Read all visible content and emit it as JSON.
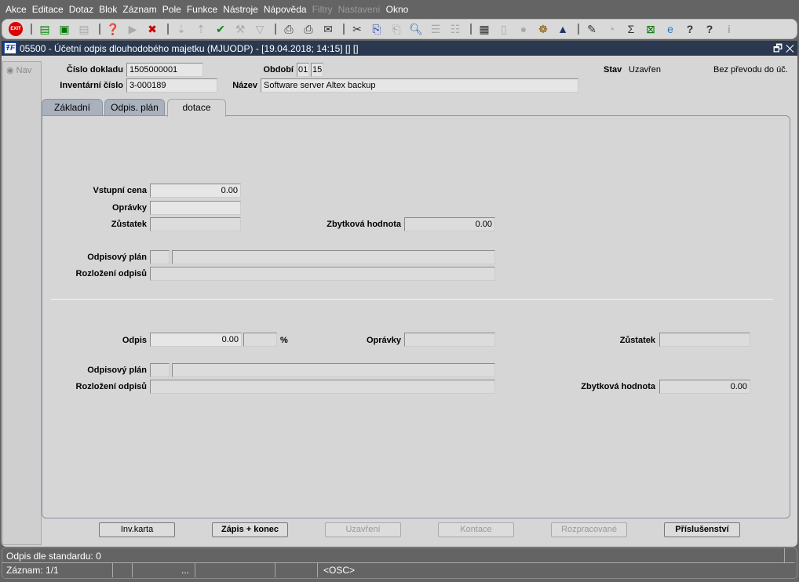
{
  "menu": [
    "Akce",
    "Editace",
    "Dotaz",
    "Blok",
    "Záznam",
    "Pole",
    "Funkce",
    "Nástroje",
    "Nápověda",
    "Filtry",
    "Nastavení",
    "Okno"
  ],
  "menu_disabled": [
    "Filtry",
    "Nastavení"
  ],
  "toolbar": [
    "exit-icon",
    "insert-record-icon",
    "save-record-icon",
    "delete-record-icon",
    "query-icon",
    "execute-query-icon",
    "cancel-query-icon",
    "sort-asc-icon",
    "sort-desc-icon",
    "commit-icon",
    "tools-icon",
    "filter-icon",
    "print-icon",
    "print-setup-icon",
    "mail-icon",
    "cut-icon",
    "copy-icon",
    "paste-icon",
    "find-icon",
    "indent-icon",
    "columns-icon",
    "report-icon",
    "document-icon",
    "globe-icon",
    "wheel-icon",
    "eye-icon",
    "edit-icon",
    "clock-icon",
    "sum-icon",
    "excel-icon",
    "ie-icon",
    "help-icon",
    "help-window-icon",
    "info-icon"
  ],
  "title": "05500 - Účetní odpis dlouhodobého majetku (MJUODP) - [19.04.2018; 14:15] [] []",
  "nav": "Nav",
  "header": {
    "cislo_label": "Číslo dokladu",
    "cislo": "1505000001",
    "obdobi_label": "Období",
    "obdobi_m": "01",
    "obdobi_y": "15",
    "stav_label": "Stav",
    "stav": "Uzavřen",
    "prevod": "Bez převodu do úč.",
    "inv_label": "Inventární číslo",
    "inv": "3-000189",
    "nazev_label": "Název",
    "nazev": "Software server Altex backup"
  },
  "tabs": [
    "Základní",
    "Odpis. plán",
    "dotace"
  ],
  "top": {
    "vstupni_label": "Vstupní cena",
    "vstupni": "0.00",
    "opravky_label": "Oprávky",
    "zustatek_label": "Zůstatek",
    "zbytkova_label": "Zbytková hodnota",
    "zbytkova": "0.00",
    "plan_label": "Odpisový plán",
    "rozlozeni_label": "Rozložení odpisů"
  },
  "bottom": {
    "odpis_label": "Odpis",
    "odpis": "0.00",
    "pct": "%",
    "opravky_label": "Oprávky",
    "zustatek_label": "Zůstatek",
    "plan_label": "Odpisový plán",
    "rozlozeni_label": "Rozložení odpisů",
    "zbytkova_label": "Zbytková hodnota",
    "zbytkova": "0.00"
  },
  "buttons": [
    "Inv.karta",
    "Zápis + konec",
    "Uzavření",
    "Kontace",
    "Rozpracované",
    "Příslušenství"
  ],
  "status": {
    "line1": "Odpis dle standardu: 0",
    "record": "Záznam: 1/1",
    "ellipsis": "...",
    "mode": "<OSC>"
  }
}
